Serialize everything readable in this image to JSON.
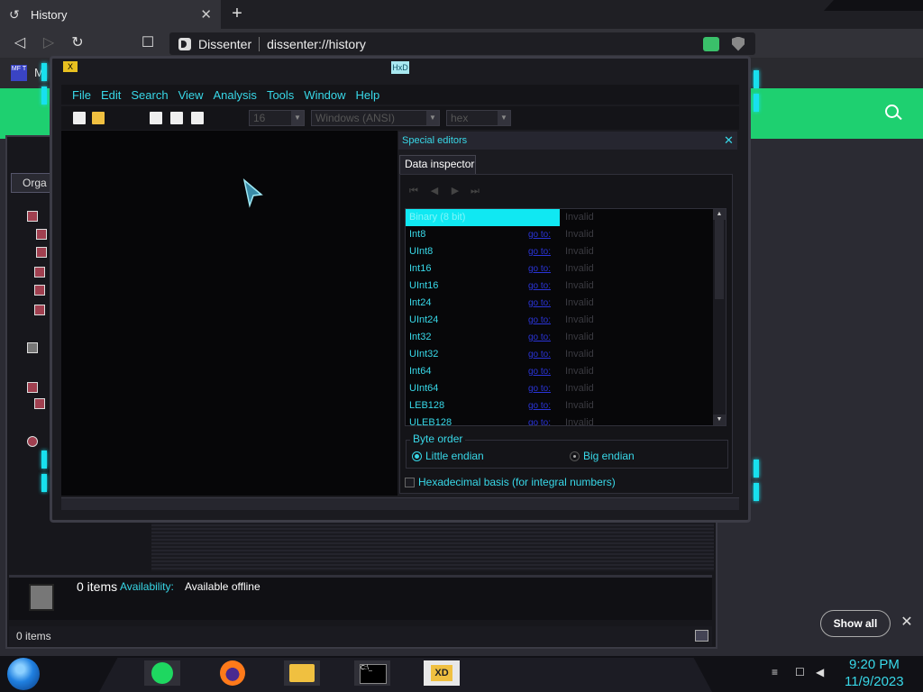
{
  "browser": {
    "tab_title": "History",
    "site_name": "Dissenter",
    "url": "dissenter://history",
    "bookmark_label": "M",
    "bookmark_icon_text": "MF T"
  },
  "library": {
    "organize_label": "Orga",
    "item_count": "0 items",
    "availability_label": "Availability:",
    "availability_value": "Available offline",
    "footer_count": "0 items"
  },
  "notification": {
    "show_all_label": "Show all"
  },
  "hxd": {
    "title_text": "HxD",
    "menu": [
      "File",
      "Edit",
      "Search",
      "View",
      "Analysis",
      "Tools",
      "Window",
      "Help"
    ],
    "toolbar": {
      "bytes_per_row": "16",
      "charset": "Windows (ANSI)",
      "offset_base": "hex"
    },
    "special_editors": {
      "title": "Special editors",
      "tab": "Data inspector",
      "rows": [
        {
          "name": "Binary (8 bit)",
          "link": "",
          "value": "Invalid"
        },
        {
          "name": "Int8",
          "link": "go to:",
          "value": "Invalid"
        },
        {
          "name": "UInt8",
          "link": "go to:",
          "value": "Invalid"
        },
        {
          "name": "Int16",
          "link": "go to:",
          "value": "Invalid"
        },
        {
          "name": "UInt16",
          "link": "go to:",
          "value": "Invalid"
        },
        {
          "name": "Int24",
          "link": "go to:",
          "value": "Invalid"
        },
        {
          "name": "UInt24",
          "link": "go to:",
          "value": "Invalid"
        },
        {
          "name": "Int32",
          "link": "go to:",
          "value": "Invalid"
        },
        {
          "name": "UInt32",
          "link": "go to:",
          "value": "Invalid"
        },
        {
          "name": "Int64",
          "link": "go to:",
          "value": "Invalid"
        },
        {
          "name": "UInt64",
          "link": "go to:",
          "value": "Invalid"
        },
        {
          "name": "LEB128",
          "link": "go to:",
          "value": "Invalid"
        },
        {
          "name": "ULEB128",
          "link": "go to:",
          "value": "Invalid"
        }
      ],
      "byte_order_label": "Byte order",
      "little_endian": "Little endian",
      "big_endian": "Big endian",
      "hex_basis_label": "Hexadecimal basis (for integral numbers)"
    }
  },
  "taskbar": {
    "time": "9:20 PM",
    "date": "11/9/2023"
  },
  "icons": {
    "tab": "history-icon",
    "accent": "#38d8e8",
    "banner": "#1ed070"
  }
}
